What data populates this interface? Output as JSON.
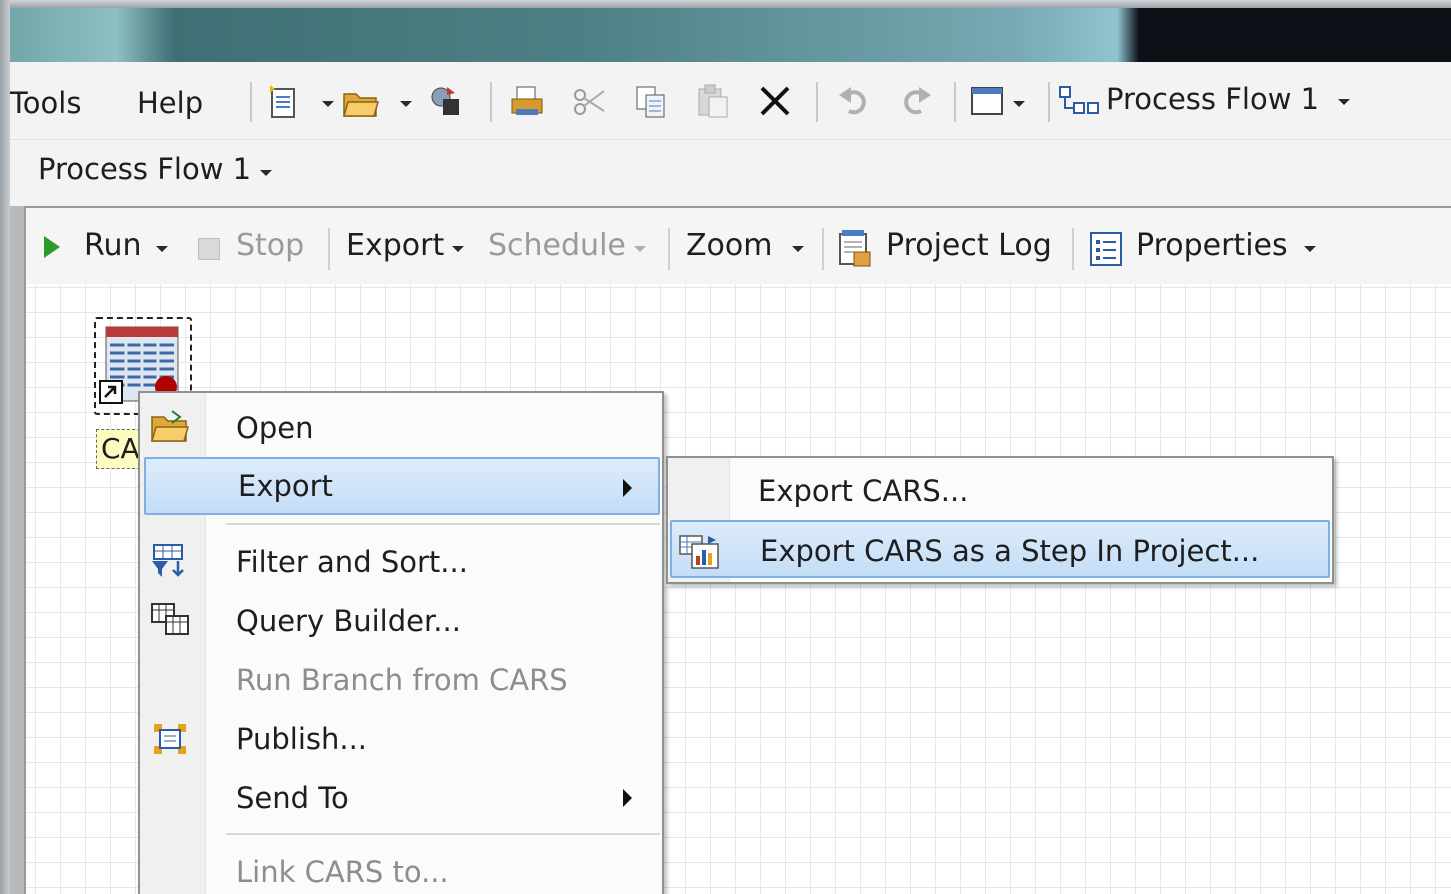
{
  "menubar": {
    "items": [
      "Tools",
      "Help"
    ],
    "process_flow_combo": "Process Flow 1"
  },
  "tab": {
    "label": "Process Flow 1"
  },
  "flow_toolbar": {
    "run": "Run",
    "stop": "Stop",
    "export": "Export",
    "schedule": "Schedule",
    "zoom": "Zoom",
    "project_log": "Project Log",
    "properties": "Properties"
  },
  "node": {
    "label": "CARS"
  },
  "context_menu": {
    "items": [
      {
        "label": "Open",
        "icon": "open-folder-icon"
      },
      {
        "label": "Export",
        "has_submenu": true
      },
      {
        "label": "Filter and Sort...",
        "icon": "filter-sort-icon"
      },
      {
        "label": "Query Builder...",
        "icon": "query-builder-icon"
      },
      {
        "label": "Run Branch from CARS",
        "disabled": true
      },
      {
        "label": "Publish...",
        "icon": "publish-icon"
      },
      {
        "label": "Send To",
        "has_submenu": true
      },
      {
        "label": "Link CARS to...",
        "disabled": true
      }
    ]
  },
  "submenu": {
    "items": [
      {
        "label": "Export CARS..."
      },
      {
        "label": "Export CARS as a Step In Project...",
        "icon": "export-step-icon"
      }
    ]
  },
  "colors": {
    "highlight": "#c4ddf6",
    "highlight_border": "#7fb0e3",
    "disabled_text": "#8d8d8d"
  }
}
